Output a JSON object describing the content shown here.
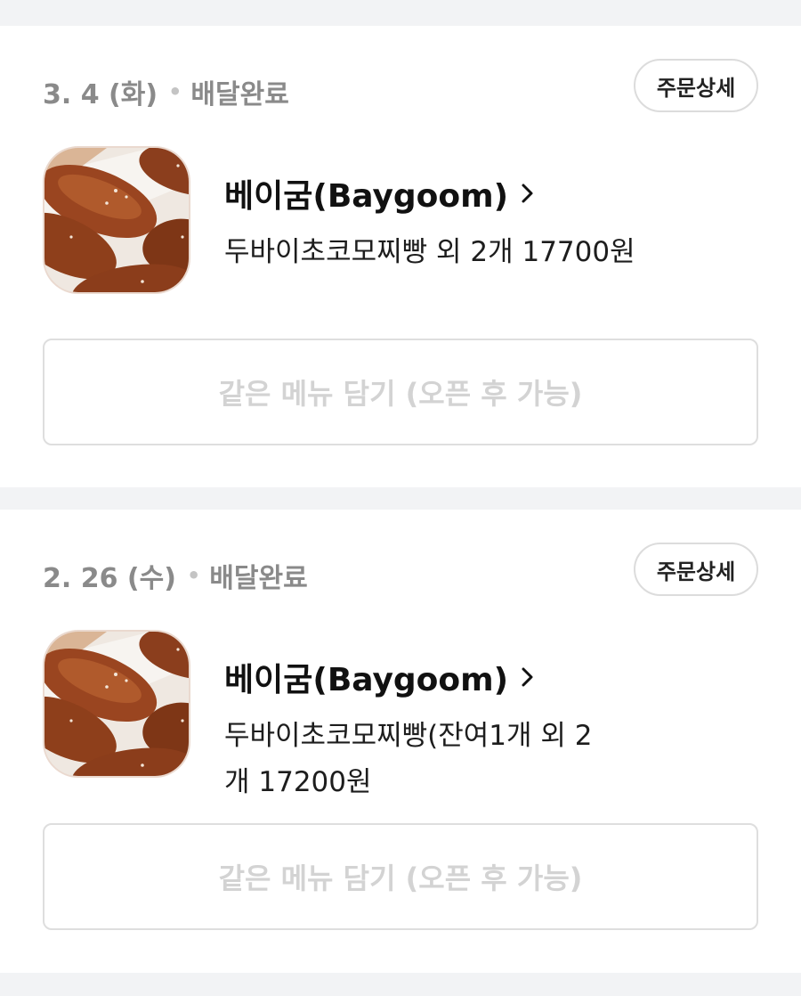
{
  "orders": [
    {
      "date": "3. 4 (화)",
      "status": "배달완료",
      "detail_label": "주문상세",
      "store_name": "베이굼(Baygoom)",
      "summary": "두바이초코모찌빵 외 2개 17700원",
      "reorder_label": "같은 메뉴 담기 (오픈 후 가능)"
    },
    {
      "date": "2. 26 (수)",
      "status": "배달완료",
      "detail_label": "주문상세",
      "store_name": "베이굼(Baygoom)",
      "summary": "두바이초코모찌빵(잔여1개 외 2개 17200원",
      "reorder_label": "같은 메뉴 담기 (오픈 후 가능)"
    }
  ],
  "separator_dot": "•",
  "icons": {
    "store_link": "chevron-right-icon",
    "thumbnail": "bread-image"
  },
  "colors": {
    "background": "#f2f3f5",
    "card": "#ffffff",
    "meta_text": "#8a8a8a",
    "disabled_text": "#d3d3d3"
  }
}
